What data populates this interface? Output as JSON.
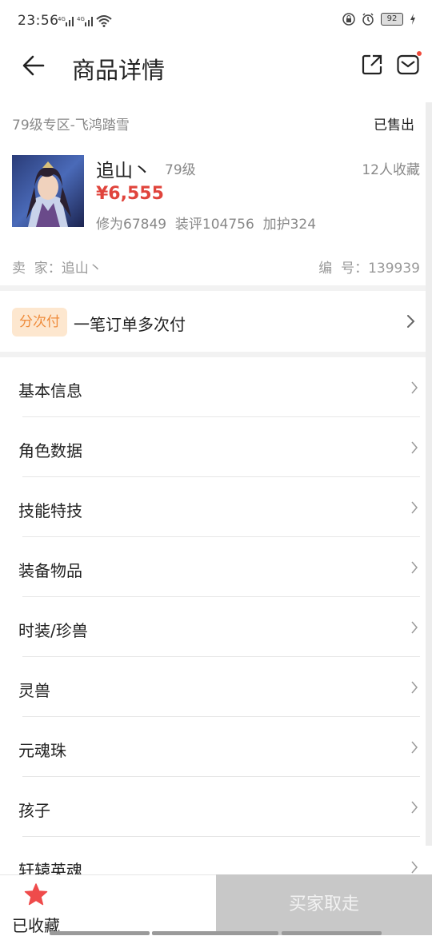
{
  "status_bar": {
    "time": "23:56",
    "signal_1": "4G",
    "signal_2": "4G",
    "battery": "92"
  },
  "nav": {
    "title": "商品详情",
    "back_icon": "arrow-left-icon",
    "share_icon": "share-icon",
    "mail_icon": "mail-icon"
  },
  "product": {
    "zone": "79级专区-飞鸿踏雪",
    "status": "已售出",
    "name": "追山丶",
    "level": "79级",
    "favorites": "12人收藏",
    "price": "¥6,555",
    "stats": "修为67849  装评104756  加护324",
    "seller": "卖  家：追山丶",
    "id": "编  号：139939"
  },
  "installment": {
    "tag": "分次付",
    "text": "一笔订单多次付"
  },
  "menu": [
    {
      "label": "基本信息"
    },
    {
      "label": "角色数据"
    },
    {
      "label": "技能特技"
    },
    {
      "label": "装备物品"
    },
    {
      "label": "时装/珍兽"
    },
    {
      "label": "灵兽"
    },
    {
      "label": "元魂珠"
    },
    {
      "label": "孩子"
    },
    {
      "label": "轩辕英魂"
    }
  ],
  "bottom": {
    "favorite_label": "已收藏",
    "buy_label": "买家取走"
  },
  "colors": {
    "price": "#e0443c",
    "tag_bg": "#fde7cf",
    "tag_text": "#ef8b3a",
    "star": "#ef4b4b",
    "buy_bg": "#c8c8c8"
  }
}
